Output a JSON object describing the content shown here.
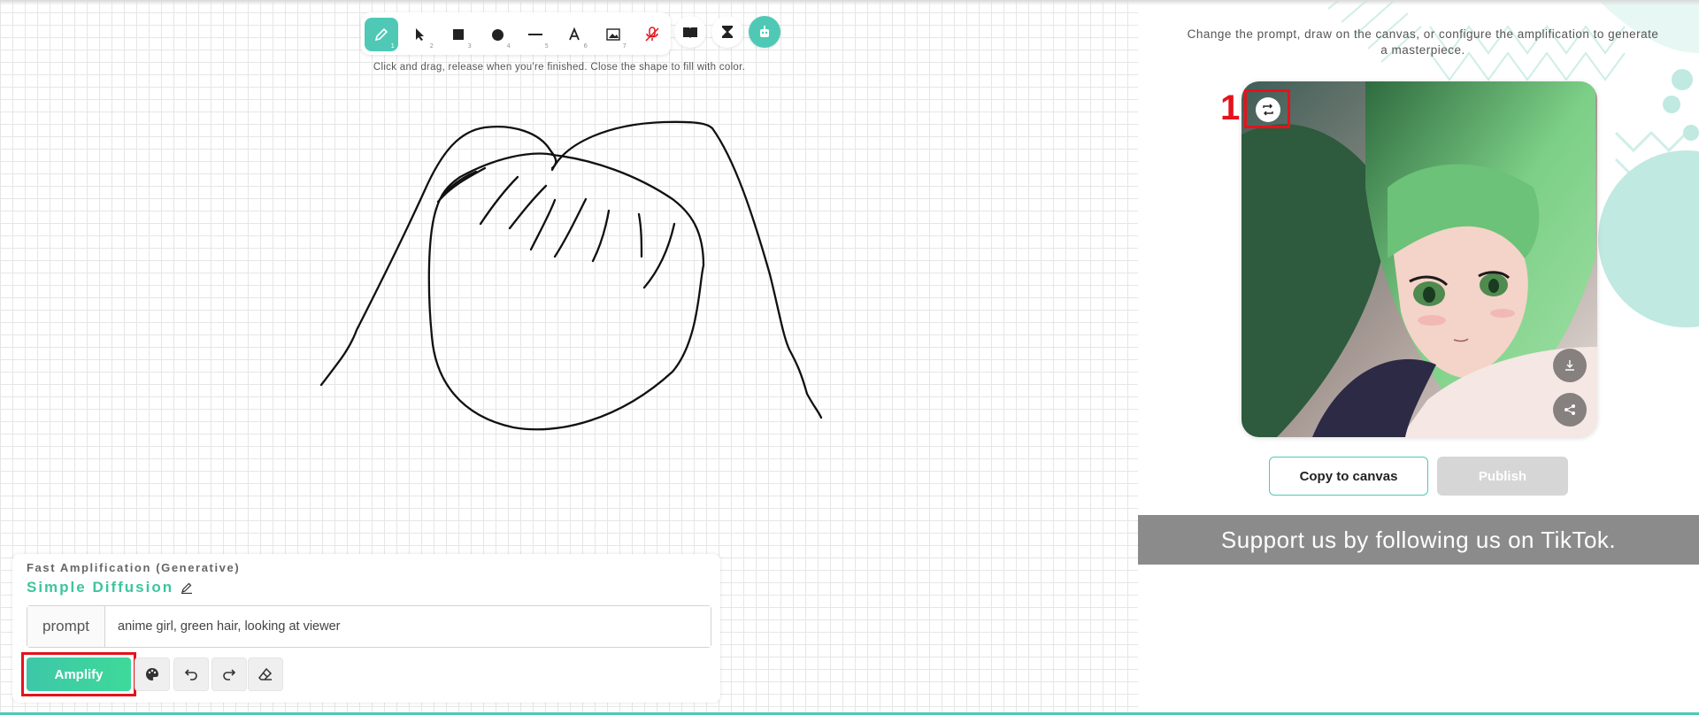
{
  "toolbar": {
    "tools": [
      {
        "name": "pencil",
        "shortcut": "1"
      },
      {
        "name": "select",
        "shortcut": "2"
      },
      {
        "name": "rectangle",
        "shortcut": "3"
      },
      {
        "name": "circle",
        "shortcut": "4"
      },
      {
        "name": "line",
        "shortcut": "5"
      },
      {
        "name": "text",
        "shortcut": "6"
      },
      {
        "name": "image",
        "shortcut": "7"
      },
      {
        "name": "mic-off",
        "shortcut": ""
      }
    ],
    "extra": [
      "book",
      "hourglass",
      "robot"
    ],
    "accent": "#4fc9b5"
  },
  "canvas": {
    "hint": "Click and drag, release when you're finished. Close the shape to fill with color."
  },
  "panel": {
    "mode": "Fast Amplification (Generative)",
    "model": "Simple Diffusion",
    "prompt_label": "prompt",
    "prompt_value": "anime girl, green hair, looking at viewer",
    "amplify_label": "Amplify"
  },
  "right": {
    "description": "Change the prompt, draw on the canvas, or configure the amplification to generate a masterpiece.",
    "marker": "1",
    "copy_label": "Copy to canvas",
    "publish_label": "Publish",
    "banner": "Support us by following us on TikTok."
  },
  "colors": {
    "highlight": "#e4131c",
    "banner_bg": "#8b8b8b",
    "model_color": "#3dc59d"
  }
}
